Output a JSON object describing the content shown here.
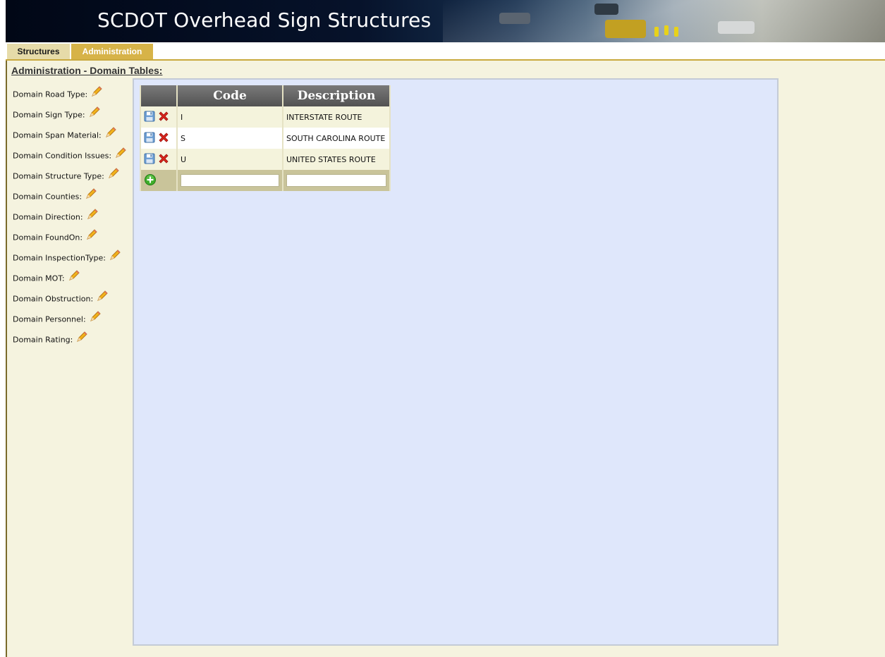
{
  "app": {
    "title": "SCDOT Overhead Sign Structures"
  },
  "tabs": [
    {
      "label": "Structures",
      "active": false
    },
    {
      "label": "Administration",
      "active": true
    }
  ],
  "page": {
    "heading": "Administration - Domain Tables:"
  },
  "sidebar": {
    "items": [
      {
        "label": "Domain Road Type:"
      },
      {
        "label": "Domain Sign Type:"
      },
      {
        "label": "Domain Span Material:"
      },
      {
        "label": "Domain Condition Issues:"
      },
      {
        "label": "Domain Structure Type:"
      },
      {
        "label": "Domain Counties:"
      },
      {
        "label": "Domain Direction:"
      },
      {
        "label": "Domain FoundOn:"
      },
      {
        "label": "Domain InspectionType:"
      },
      {
        "label": "Domain MOT:"
      },
      {
        "label": "Domain Obstruction:"
      },
      {
        "label": "Domain Personnel:"
      },
      {
        "label": "Domain Rating:"
      }
    ]
  },
  "grid": {
    "columns": [
      "",
      "Code",
      "Description"
    ],
    "rows": [
      {
        "code": "I",
        "description": "INTERSTATE ROUTE"
      },
      {
        "code": "S",
        "description": "SOUTH CAROLINA ROUTE"
      },
      {
        "code": "U",
        "description": "UNITED STATES ROUTE"
      }
    ],
    "new_row": {
      "code": "",
      "description": ""
    }
  },
  "icons": {
    "edit": "pencil-icon",
    "save": "save-disk-icon",
    "delete": "delete-x-icon",
    "add": "add-plus-icon"
  },
  "colors": {
    "tab_active": "#d7b348",
    "tab_inactive": "#e6dba9",
    "content_bg": "#f5f3df",
    "panel_bg": "#dfe7fb",
    "grid_header": "#5f5f5f",
    "delete_red": "#d9251c",
    "add_green": "#3fae2a"
  }
}
